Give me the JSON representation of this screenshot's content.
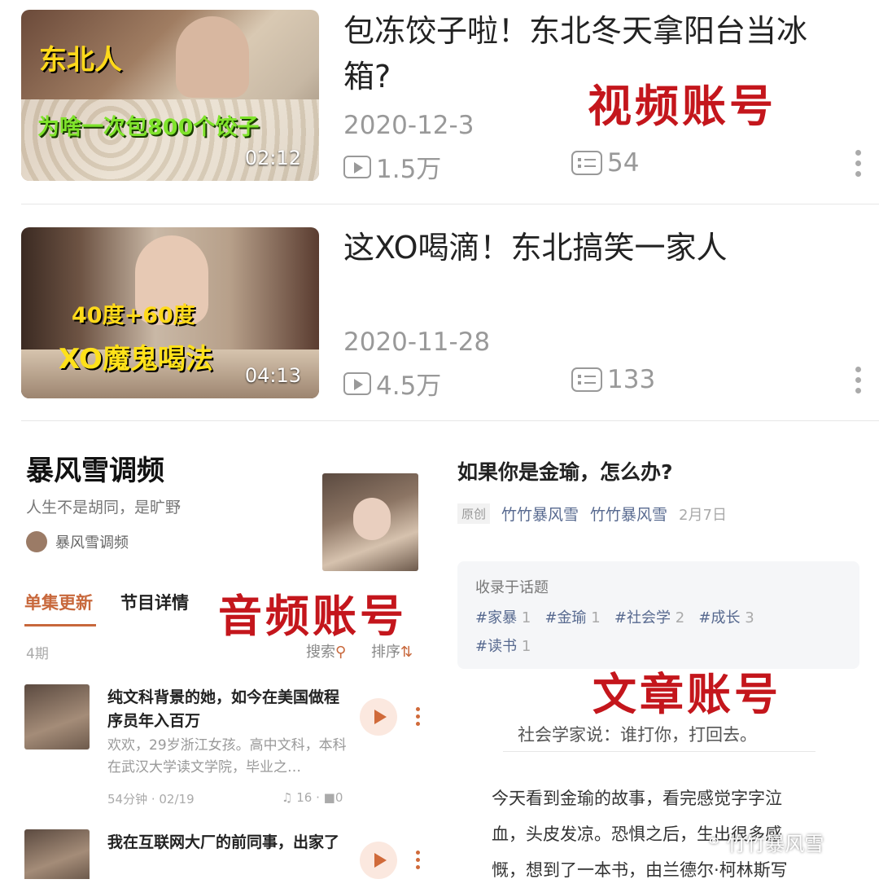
{
  "video_section": {
    "stamp": "视频账号",
    "items": [
      {
        "title": "包冻饺子啦！东北冬天拿阳台当冰箱?",
        "date": "2020-12-3",
        "plays": "1.5万",
        "comments": "54",
        "duration": "02:12",
        "thumb_caption_1": "东北人",
        "thumb_caption_2": "为啥一次包800个饺子"
      },
      {
        "title": "这XO喝滴！东北搞笑一家人",
        "date": "2020-11-28",
        "plays": "4.5万",
        "comments": "133",
        "duration": "04:13",
        "thumb_caption_1": "40度+60度",
        "thumb_caption_2": "XO魔鬼喝法"
      }
    ]
  },
  "audio_section": {
    "stamp": "音频账号",
    "title": "暴风雪调频",
    "subtitle": "人生不是胡同，是旷野",
    "author": "暴风雪调频",
    "tabs": [
      "单集更新",
      "节目详情"
    ],
    "count": "4期",
    "search": "搜索",
    "sort": "排序",
    "episodes": [
      {
        "title": "纯文科背景的她，如今在美国做程序员年入百万",
        "desc": "欢欢，29岁浙江女孩。高中文科，本科在武汉大学读文学院，毕业之…",
        "meta": "54分钟 · 02/19",
        "listens": "16",
        "comments": "0"
      },
      {
        "title": "我在互联网大厂的前同事，出家了",
        "desc": "",
        "meta": "",
        "listens": "",
        "comments": ""
      }
    ]
  },
  "article_section": {
    "stamp": "文章账号",
    "title": "如果你是金瑜，怎么办?",
    "badge": "原创",
    "author1": "竹竹暴风雪",
    "author2": "竹竹暴风雪",
    "date": "2月7日",
    "topics_label": "收录于话题",
    "tags": [
      {
        "name": "#家暴",
        "count": "1"
      },
      {
        "name": "#金瑜",
        "count": "1"
      },
      {
        "name": "#社会学",
        "count": "2"
      },
      {
        "name": "#成长",
        "count": "3"
      },
      {
        "name": "#读书",
        "count": "1"
      }
    ],
    "quote": "社会学家说：谁打你，打回去。",
    "paragraph_lines": [
      "今天看到金瑜的故事，看完感觉字字泣",
      "血，头皮发凉。恐惧之后，生出很多感",
      "慨，想到了一本书，由兰德尔·柯林斯写"
    ]
  },
  "watermark": "竹竹暴风雪"
}
